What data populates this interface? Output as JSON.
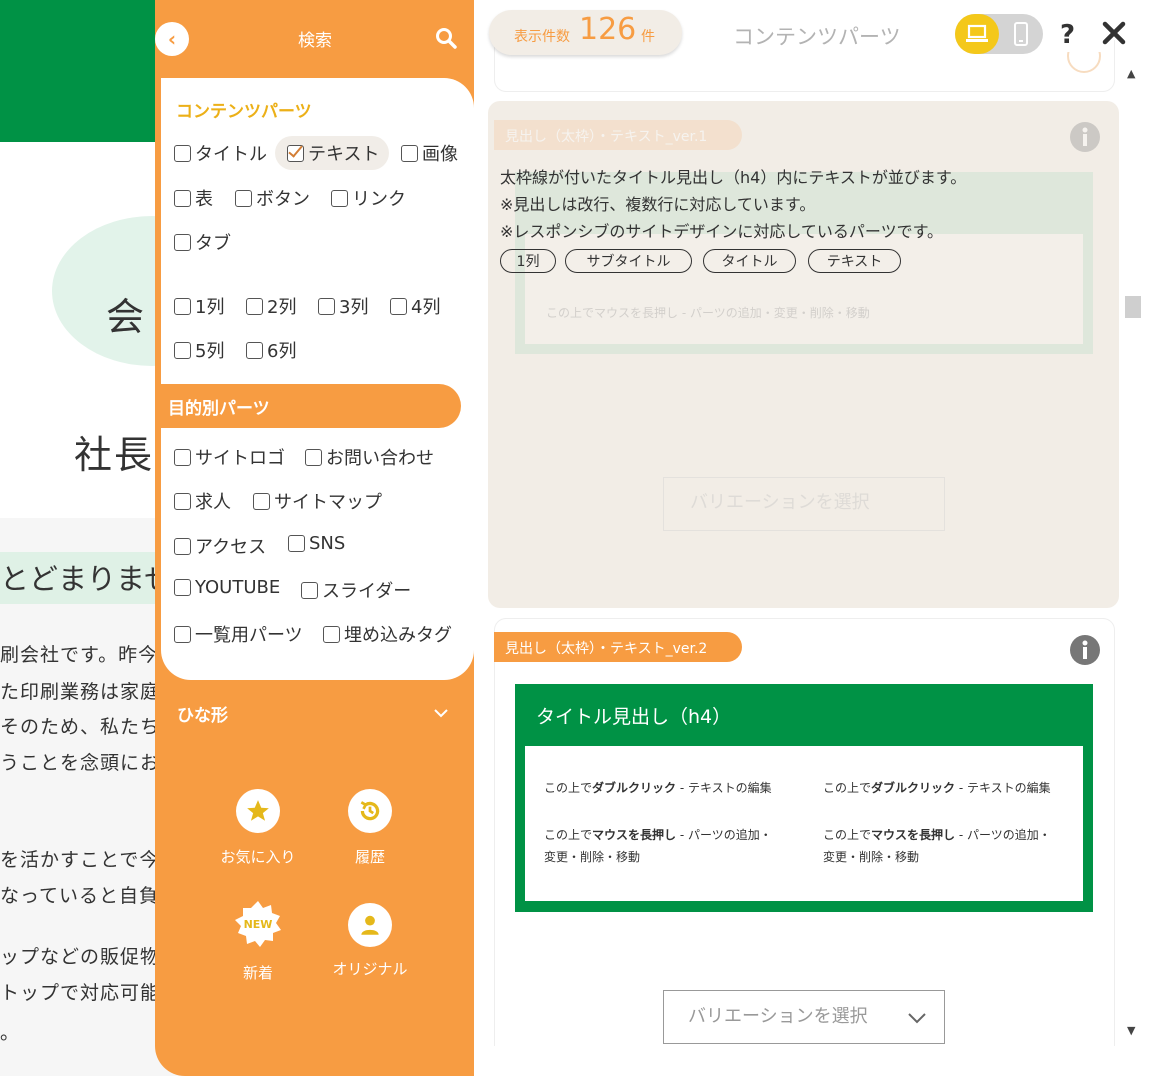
{
  "background": {
    "heading_fragment": "会",
    "subheading_fragment": "社長",
    "highlight_fragment": "とどまりませ",
    "lines": [
      "刷会社です。昨今",
      "た印刷業務は家庭",
      "そのため、私たちに",
      "うことを念頭にお",
      "を活かすことで今",
      "なっていると自負",
      "ップなどの販促物",
      "トップで対応可能",
      "。"
    ]
  },
  "filter_panel": {
    "search_title": "検索",
    "content_parts_heading": "コンテンツパーツ",
    "content_parts": [
      {
        "label": "タイトル",
        "checked": false
      },
      {
        "label": "テキスト",
        "checked": true
      },
      {
        "label": "画像",
        "checked": false
      },
      {
        "label": "表",
        "checked": false
      },
      {
        "label": "ボタン",
        "checked": false
      },
      {
        "label": "リンク",
        "checked": false
      },
      {
        "label": "タブ",
        "checked": false
      }
    ],
    "columns": [
      {
        "label": "1列",
        "checked": false
      },
      {
        "label": "2列",
        "checked": false
      },
      {
        "label": "3列",
        "checked": false
      },
      {
        "label": "4列",
        "checked": false
      },
      {
        "label": "5列",
        "checked": false
      },
      {
        "label": "6列",
        "checked": false
      }
    ],
    "purpose_heading": "目的別パーツ",
    "purpose_parts": [
      {
        "label": "サイトロゴ",
        "checked": false
      },
      {
        "label": "お問い合わせ",
        "checked": false
      },
      {
        "label": "求人",
        "checked": false
      },
      {
        "label": "サイトマップ",
        "checked": false
      },
      {
        "label": "アクセス",
        "checked": false
      },
      {
        "label": "SNS",
        "checked": false
      },
      {
        "label": "YOUTUBE",
        "checked": false
      },
      {
        "label": "スライダー",
        "checked": false
      },
      {
        "label": "一覧用パーツ",
        "checked": false
      },
      {
        "label": "埋め込みタグ",
        "checked": false
      }
    ],
    "template_heading": "ひな形",
    "shortcuts": [
      {
        "label": "お気に入り",
        "icon": "star-icon"
      },
      {
        "label": "履歴",
        "icon": "history-icon"
      },
      {
        "label": "新着",
        "icon": "new-badge-icon",
        "badge": "NEW"
      },
      {
        "label": "オリジナル",
        "icon": "user-icon"
      }
    ]
  },
  "header": {
    "count_label": "表示件数",
    "count_value": "126",
    "count_unit": "件",
    "title": "コンテンツパーツ",
    "help": "?"
  },
  "card_hover": {
    "tag": "見出し（太枠）・テキスト_ver.1",
    "description": [
      "太枠線が付いたタイトル見出し（h4）内にテキストが並びます。",
      "※見出しは改行、複数行に対応しています。",
      "※レスポンシブのサイトデザインに対応しているパーツです。"
    ],
    "chips": [
      "1列",
      "サブタイトル",
      "タイトル",
      "テキスト"
    ],
    "ghost_text": "この上でマウスを長押し - パーツの追加・変更・削除・移動",
    "select_placeholder": "バリエーションを選択"
  },
  "card2": {
    "tag": "見出し（太枠）・テキスト_ver.2",
    "preview_title": "タイトル見出し（h4）",
    "dbl_pre": "この上で",
    "dbl_bold": "ダブルクリック",
    "dbl_post": " - テキストの編集",
    "hold_pre": "この上で",
    "hold_bold": "マウスを長押し",
    "hold_post": " - パーツの追加・",
    "hold_line2": "変更・削除・移動",
    "select_placeholder": "バリエーションを選択"
  },
  "colors": {
    "orange": "#f79c42",
    "green": "#009245",
    "yellow": "#f4c81a",
    "heading_yellow": "#ecb018"
  }
}
